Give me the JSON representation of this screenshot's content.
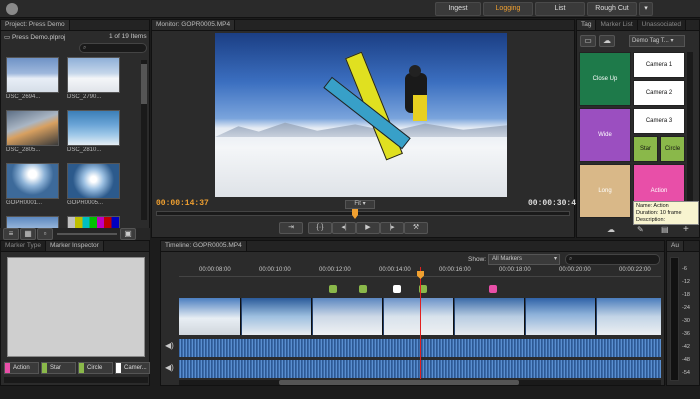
{
  "workspaces": [
    {
      "label": "Ingest",
      "active": false
    },
    {
      "label": "Logging",
      "active": true
    },
    {
      "label": "List",
      "active": false
    },
    {
      "label": "Rough Cut",
      "active": false
    }
  ],
  "project": {
    "tab": "Project: Press Demo",
    "file": "Press Demo.plproj",
    "count": "1 of 19 Items",
    "clips": [
      "DSC_2694...",
      "DSC_2790...",
      "DSC_2805...",
      "DSC_2810...",
      "GOPR0001...",
      "GOPR0005...",
      "",
      ""
    ]
  },
  "monitor": {
    "tab": "Monitor: GOPR0005.MP4",
    "current_tc": "00:00:14:37",
    "duration_tc": "00:00:30:47",
    "zoom": "Fit",
    "playhead_fraction": 0.48
  },
  "tags": {
    "tabs": [
      "Tag",
      "Marker List",
      "Unassociated"
    ],
    "preset": "Demo Tag T...",
    "tiles": [
      {
        "label": "Close Up",
        "color": "#1e7a4a"
      },
      {
        "label": "Camera 1",
        "color": "#ffffff"
      },
      {
        "label": "Camera 2",
        "color": "#ffffff"
      },
      {
        "label": "Wide",
        "color": "#9b4fc0"
      },
      {
        "label": "Camera 3",
        "color": "#ffffff"
      },
      {
        "label": "Star",
        "color": "#8ab84a"
      },
      {
        "label": "Circle",
        "color": "#8ab84a"
      },
      {
        "label": "Long",
        "color": "#d9b888"
      },
      {
        "label": "Action",
        "color": "#e84fa8"
      }
    ],
    "tooltip": {
      "name": "Name: Action",
      "duration": "Duration: 10 frame",
      "description": "Description:"
    }
  },
  "marker_panel": {
    "tabs": [
      "Marker Type",
      "Marker Inspector"
    ],
    "types": [
      {
        "label": "Action",
        "color": "#e84fa8"
      },
      {
        "label": "Star",
        "color": "#8ab84a"
      },
      {
        "label": "Circle",
        "color": "#8ab84a"
      },
      {
        "label": "Camer...",
        "color": "#ffffff"
      }
    ]
  },
  "timeline": {
    "tab": "Timeline: GOPR0005.MP4",
    "show_label": "Show:",
    "show_value": "All Markers",
    "ruler": [
      "00:00:08:00",
      "00:00:10:00",
      "00:00:12:00",
      "00:00:14:00",
      "00:00:16:00",
      "00:00:18:00",
      "00:00:20:00",
      "00:00:22:00"
    ]
  },
  "audio": {
    "tab": "Au",
    "scale": [
      "-6",
      "-12",
      "-18",
      "-24",
      "-30",
      "-36",
      "-42",
      "-48",
      "-54"
    ]
  }
}
